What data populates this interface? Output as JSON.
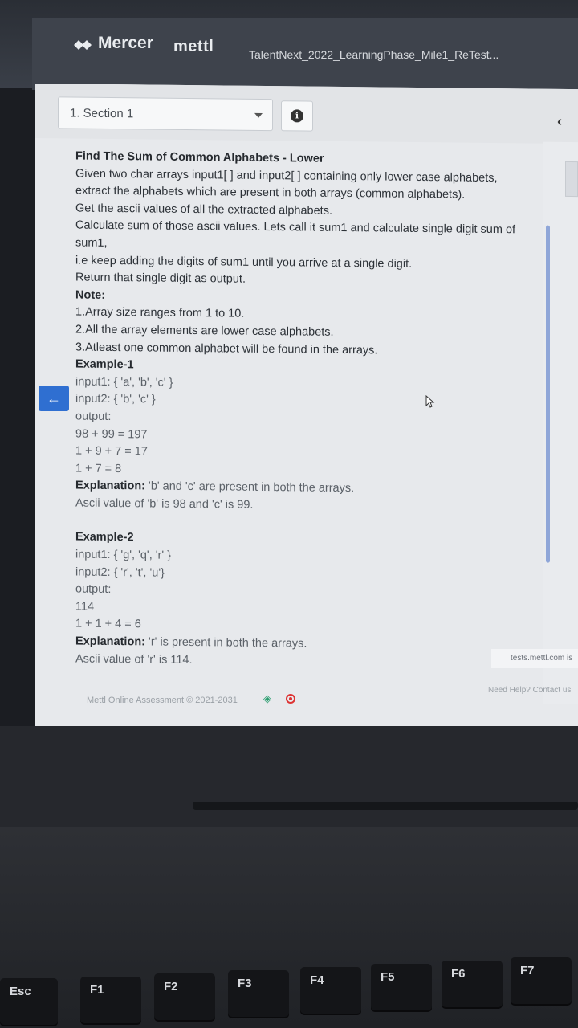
{
  "header": {
    "brand": "Mercer",
    "brand2": "mettl",
    "test_title": "TalentNext_2022_LearningPhase_Mile1_ReTest..."
  },
  "toolbar": {
    "section_select": "1. Section 1",
    "info_icon": "info-icon",
    "collapse_icon": "chevron-left-icon"
  },
  "question": {
    "title": "Find The Sum of Common Alphabets - Lower",
    "lines": [
      "Given two char arrays input1[ ] and input2[ ] containing only lower case alphabets,",
      "extract the alphabets  which are present in both arrays (common alphabets).",
      "Get the ascii values of all the extracted alphabets.",
      "Calculate sum of those ascii values. Lets call it sum1 and calculate single digit sum of",
      "sum1,",
      "i.e keep adding the digits of sum1 until you arrive at a single digit.",
      "Return that single digit as output."
    ],
    "note_label": "Note:",
    "notes": [
      "1.Array size ranges from 1 to 10.",
      "2.All the array elements are lower case alphabets.",
      "3.Atleast one common alphabet will be found in the arrays."
    ],
    "example1": {
      "label": "Example-1",
      "input1": "input1: { 'a', 'b', 'c' }",
      "input2": "input2: { 'b', 'c' }",
      "output_label": "output:",
      "calc1": "98 + 99 = 197",
      "calc2": "1 + 9 + 7 = 17",
      "calc3": "1 + 7 = 8",
      "explanation_label": "Explanation:",
      "explanation": " 'b' and 'c' are present in both the arrays.",
      "explanation2": "Ascii value of 'b' is 98 and 'c' is 99."
    },
    "example2": {
      "label": "Example-2",
      "input1": "input1: { 'g', 'q', 'r' }",
      "input2": "input2: { 'r', 't', 'u'}",
      "output_label": "output:",
      "calc1": "114",
      "calc2": "1 + 1 + 4 = 6",
      "explanation_label": "Explanation:",
      "explanation": " 'r' is present in both the arrays.",
      "explanation2": "Ascii value of 'r' is 114."
    }
  },
  "footer": {
    "copyright": "Mettl Online Assessment © 2021-2031",
    "tooltip": "tests.mettl.com is",
    "need_help": "Need Help? Contact us"
  },
  "keyboard": {
    "esc": "Esc",
    "keys": [
      "F1",
      "F2",
      "F3",
      "F4",
      "F5",
      "F6",
      "F7"
    ]
  }
}
